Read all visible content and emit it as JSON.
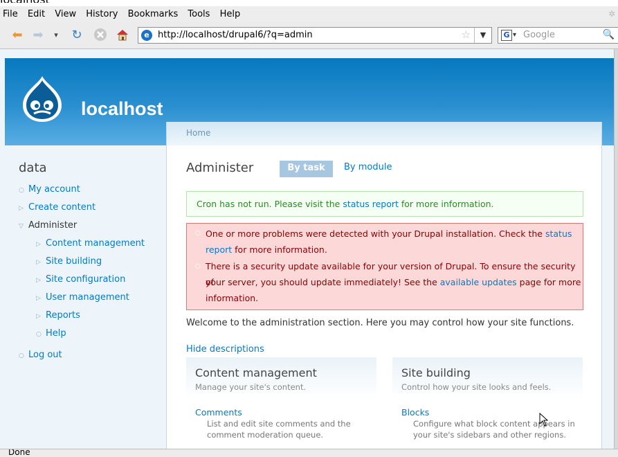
{
  "window": {
    "title_fragment": "localhost"
  },
  "menubar": {
    "items": [
      "File",
      "Edit",
      "View",
      "History",
      "Bookmarks",
      "Tools",
      "Help"
    ]
  },
  "navbar": {
    "url": "http://localhost/drupal6/?q=admin",
    "search_placeholder": "Google",
    "icons": [
      "back-icon",
      "forward-icon",
      "history-dropdown-icon",
      "reload-icon",
      "stop-icon",
      "home-icon"
    ]
  },
  "site": {
    "name": "localhost",
    "brand_color": "#0779bf"
  },
  "sidebar": {
    "title": "data",
    "items": [
      {
        "label": "My account"
      },
      {
        "label": "Create content"
      },
      {
        "label": "Administer"
      },
      {
        "label": "Content management"
      },
      {
        "label": "Site building"
      },
      {
        "label": "Site configuration"
      },
      {
        "label": "User management"
      },
      {
        "label": "Reports"
      },
      {
        "label": "Help"
      },
      {
        "label": "Log out"
      }
    ]
  },
  "breadcrumb": {
    "home": "Home"
  },
  "main": {
    "title": "Administer",
    "tabs": [
      {
        "label": "By task",
        "active": true
      },
      {
        "label": "By module",
        "active": false
      }
    ],
    "status_message": {
      "before": "Cron has not run. Please visit the ",
      "link": "status report",
      "after": " for more information."
    },
    "errors": [
      {
        "line1_before": "One or more problems were detected with your Drupal installation. Check the ",
        "line1_link": "status",
        "line2_link": "report",
        "line2_after": " for more information."
      },
      {
        "line1": "There is a security update available for your version of Drupal. To ensure the security of",
        "line2_before": "your server, you should update immediately! See the ",
        "line2_link": "available updates",
        "line2_after": " page for more",
        "line3": "information."
      }
    ],
    "welcome": "Welcome to the administration section. Here you may control how your site functions.",
    "hide_descriptions": "Hide descriptions",
    "panels": [
      {
        "title": "Content management",
        "desc": "Manage your site's content.",
        "item": "Comments",
        "item_desc": "List and edit site comments and the comment moderation queue."
      },
      {
        "title": "Site building",
        "desc": "Control how your site looks and feels.",
        "item": "Blocks",
        "item_desc": "Configure what block content appears in your site's sidebars and other regions."
      }
    ]
  },
  "statusbar": {
    "text": "Done"
  }
}
